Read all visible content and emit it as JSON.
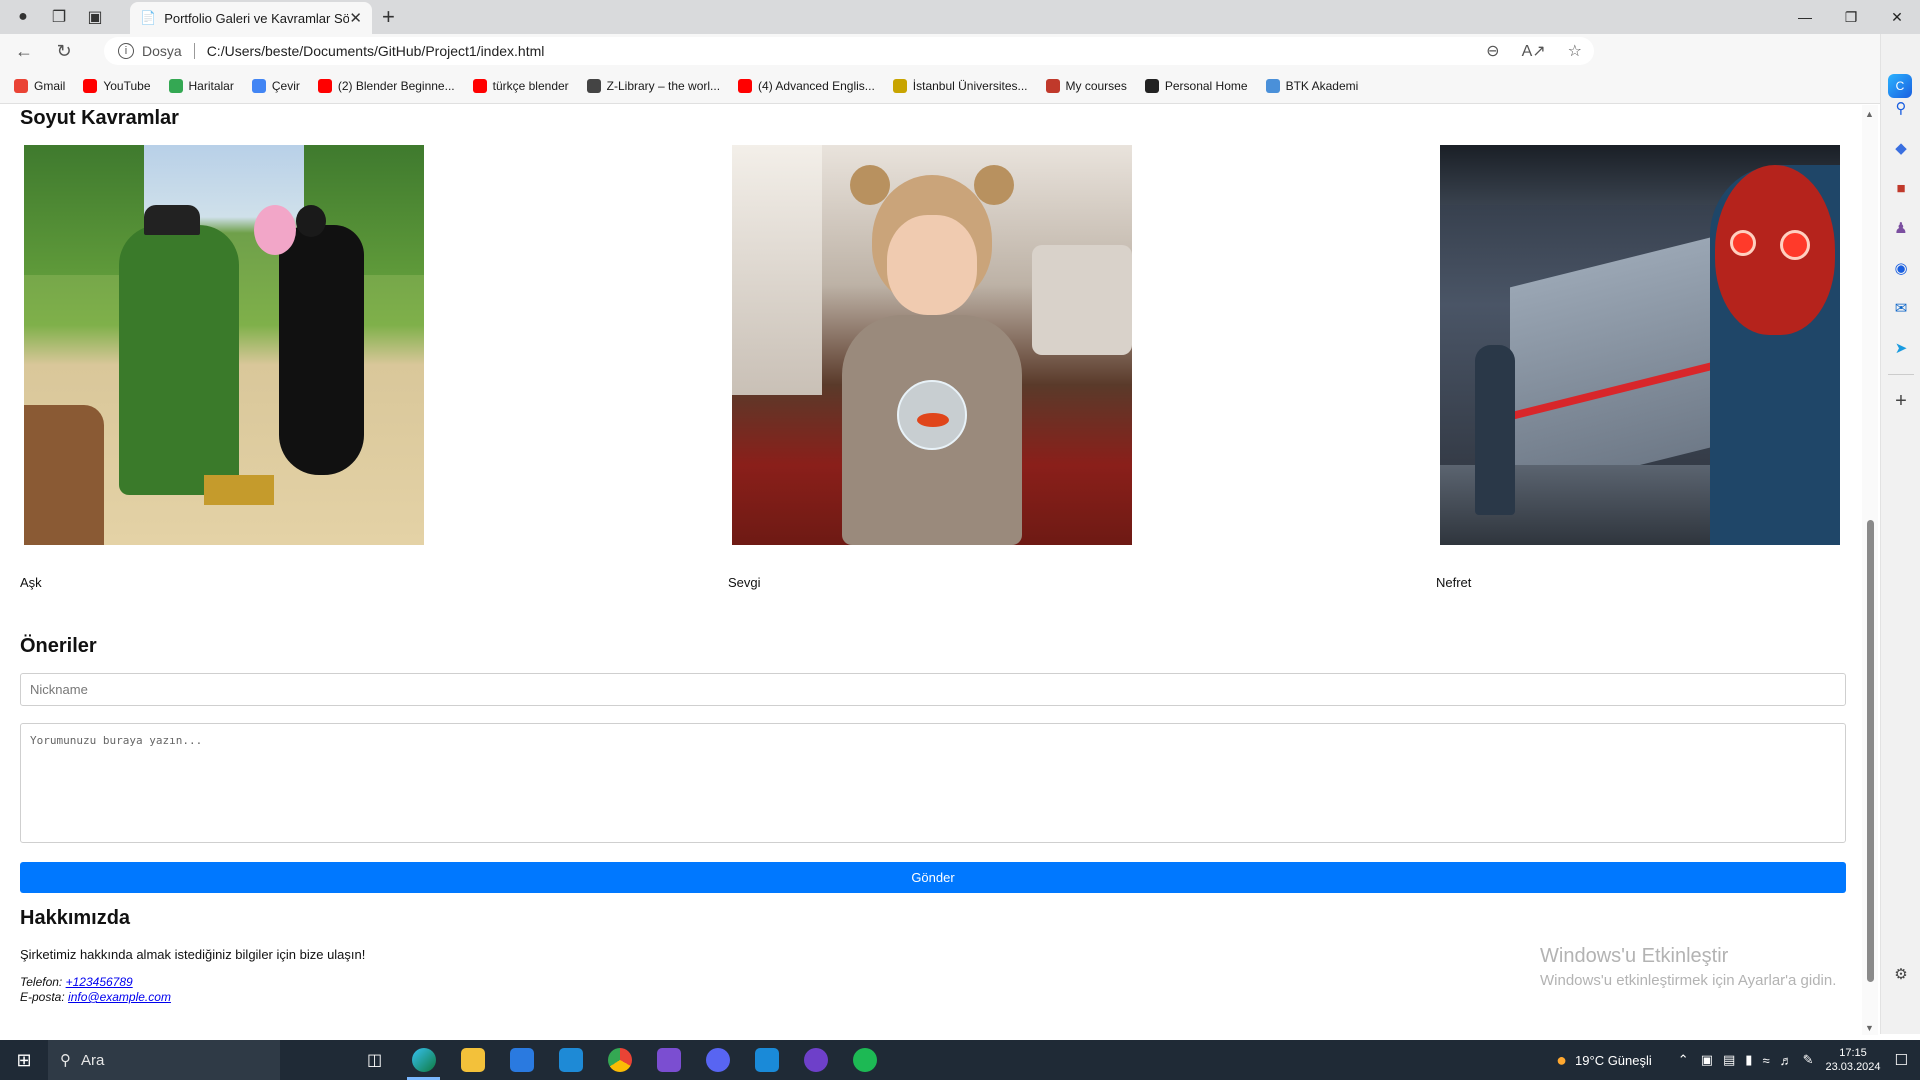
{
  "browser": {
    "tab_title": "Portfolio Galeri ve Kavramlar Sö",
    "address_label": "Dosya",
    "address_url": "C:/Users/beste/Documents/GitHub/Project1/index.html",
    "bookmarks": [
      {
        "label": "Gmail",
        "color": "#ea4335"
      },
      {
        "label": "YouTube",
        "color": "#ff0000"
      },
      {
        "label": "Haritalar",
        "color": "#34a853"
      },
      {
        "label": "Çevir",
        "color": "#4285f4"
      },
      {
        "label": "(2) Blender Beginne...",
        "color": "#ff0000"
      },
      {
        "label": "türkçe blender",
        "color": "#ff0000"
      },
      {
        "label": "Z-Library – the worl...",
        "color": "#444444"
      },
      {
        "label": "(4) Advanced Englis...",
        "color": "#ff0000"
      },
      {
        "label": "İstanbul Üniversites...",
        "color": "#c8a400"
      },
      {
        "label": "My courses",
        "color": "#c0392b"
      },
      {
        "label": "Personal Home",
        "color": "#222222"
      },
      {
        "label": "BTK Akademi",
        "color": "#4a90d9"
      }
    ]
  },
  "page": {
    "section_concepts": "Soyut Kavramlar",
    "gallery": [
      {
        "caption": "Aşk"
      },
      {
        "caption": "Sevgi"
      },
      {
        "caption": "Nefret"
      }
    ],
    "section_suggestions": "Öneriler",
    "nickname_placeholder": "Nickname",
    "comment_placeholder": "Yorumunuzu buraya yazın...",
    "send_label": "Gönder",
    "section_about": "Hakkımızda",
    "about_text": "Şirketimiz hakkında almak istediğiniz bilgiler için bize ulaşın!",
    "phone_label": "Telefon:",
    "phone_value": "+123456789",
    "email_label": "E-posta:",
    "email_value": "info@example.com"
  },
  "watermark": {
    "line1": "Windows'u Etkinleştir",
    "line2": "Windows'u etkinleştirmek için Ayarlar'a gidin."
  },
  "taskbar": {
    "search_label": "Ara",
    "weather": "19°C  Güneşli",
    "time": "17:15",
    "date": "23.03.2024"
  }
}
